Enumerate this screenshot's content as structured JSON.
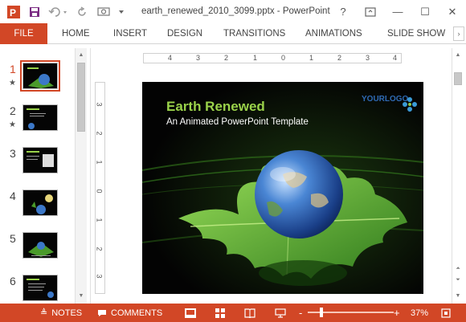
{
  "app": {
    "title": "earth_renewed_2010_3099.pptx - PowerPoint",
    "brand_color": "#d24726"
  },
  "window_controls": [
    "?",
    "⧉",
    "—",
    "☐",
    "✕"
  ],
  "ribbon": {
    "file": "FILE",
    "tabs": [
      "HOME",
      "INSERT",
      "DESIGN",
      "TRANSITIONS",
      "ANIMATIONS",
      "SLIDE SHOW"
    ]
  },
  "thumbnails": [
    {
      "num": "1",
      "star": "★"
    },
    {
      "num": "2",
      "star": "★"
    },
    {
      "num": "3",
      "star": ""
    },
    {
      "num": "4",
      "star": ""
    },
    {
      "num": "5",
      "star": ""
    },
    {
      "num": "6",
      "star": ""
    }
  ],
  "ruler": {
    "h": [
      "4",
      "3",
      "2",
      "1",
      "0",
      "1",
      "2",
      "3",
      "4"
    ],
    "v": [
      "3",
      "2",
      "1",
      "0",
      "1",
      "2",
      "3"
    ]
  },
  "slide": {
    "title": "Earth Renewed",
    "subtitle": "An Animated PowerPoint Template",
    "logo": "YOURLOGO"
  },
  "status": {
    "notes": "NOTES",
    "comments": "COMMENTS",
    "zoom_minus": "-",
    "zoom_plus": "+",
    "zoom": "37%"
  }
}
